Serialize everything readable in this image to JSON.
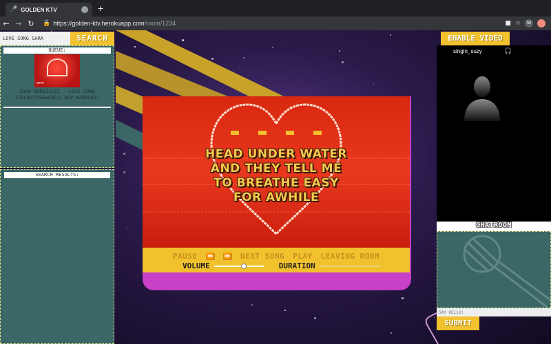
{
  "browser": {
    "tab_title": "GOLDEN KTV",
    "url_host": "https://golden-ktv.herokuapp.com",
    "url_path": "/room/1234",
    "profile_initial": "M"
  },
  "left": {
    "search_value": "LOVE SONG SARA",
    "search_button": "SEARCH",
    "queue_header": "QUEUE:",
    "queue_items": [
      {
        "title_line1": "SARA BAREILLES - LOVE SONG",
        "title_line2": "(VALENTINE&#39;S DAY KARAOKE)",
        "thumb_badge": "vevo"
      }
    ],
    "results_header": "SEARCH RESULTS:"
  },
  "player": {
    "lyrics": [
      "HEAD UNDER WATER",
      "AND THEY TELL ME",
      "TO BREATHE EASY",
      "FOR AWHILE"
    ],
    "controls": {
      "pause": "PAUSE",
      "rewind": "⏪",
      "forward": "⏩",
      "next_song": "NEXT SONG",
      "play": "PLAY",
      "leaving_room": "LEAVING ROOM",
      "volume_label": "VOLUME",
      "duration_label": "DURATION",
      "volume_level": 0.6
    }
  },
  "right": {
    "enable_video": "ENABLE VIDEO",
    "username": "singin_suzy",
    "chatroom_header": "CHATROOM",
    "chat_placeholder": "SAY HELLO!",
    "submit": "SUBMIT"
  },
  "colors": {
    "accent_yellow": "#f2c12e",
    "panel_teal": "#3b6766",
    "video_red": "#e9381d",
    "stage_magenta": "#c83fc8"
  }
}
